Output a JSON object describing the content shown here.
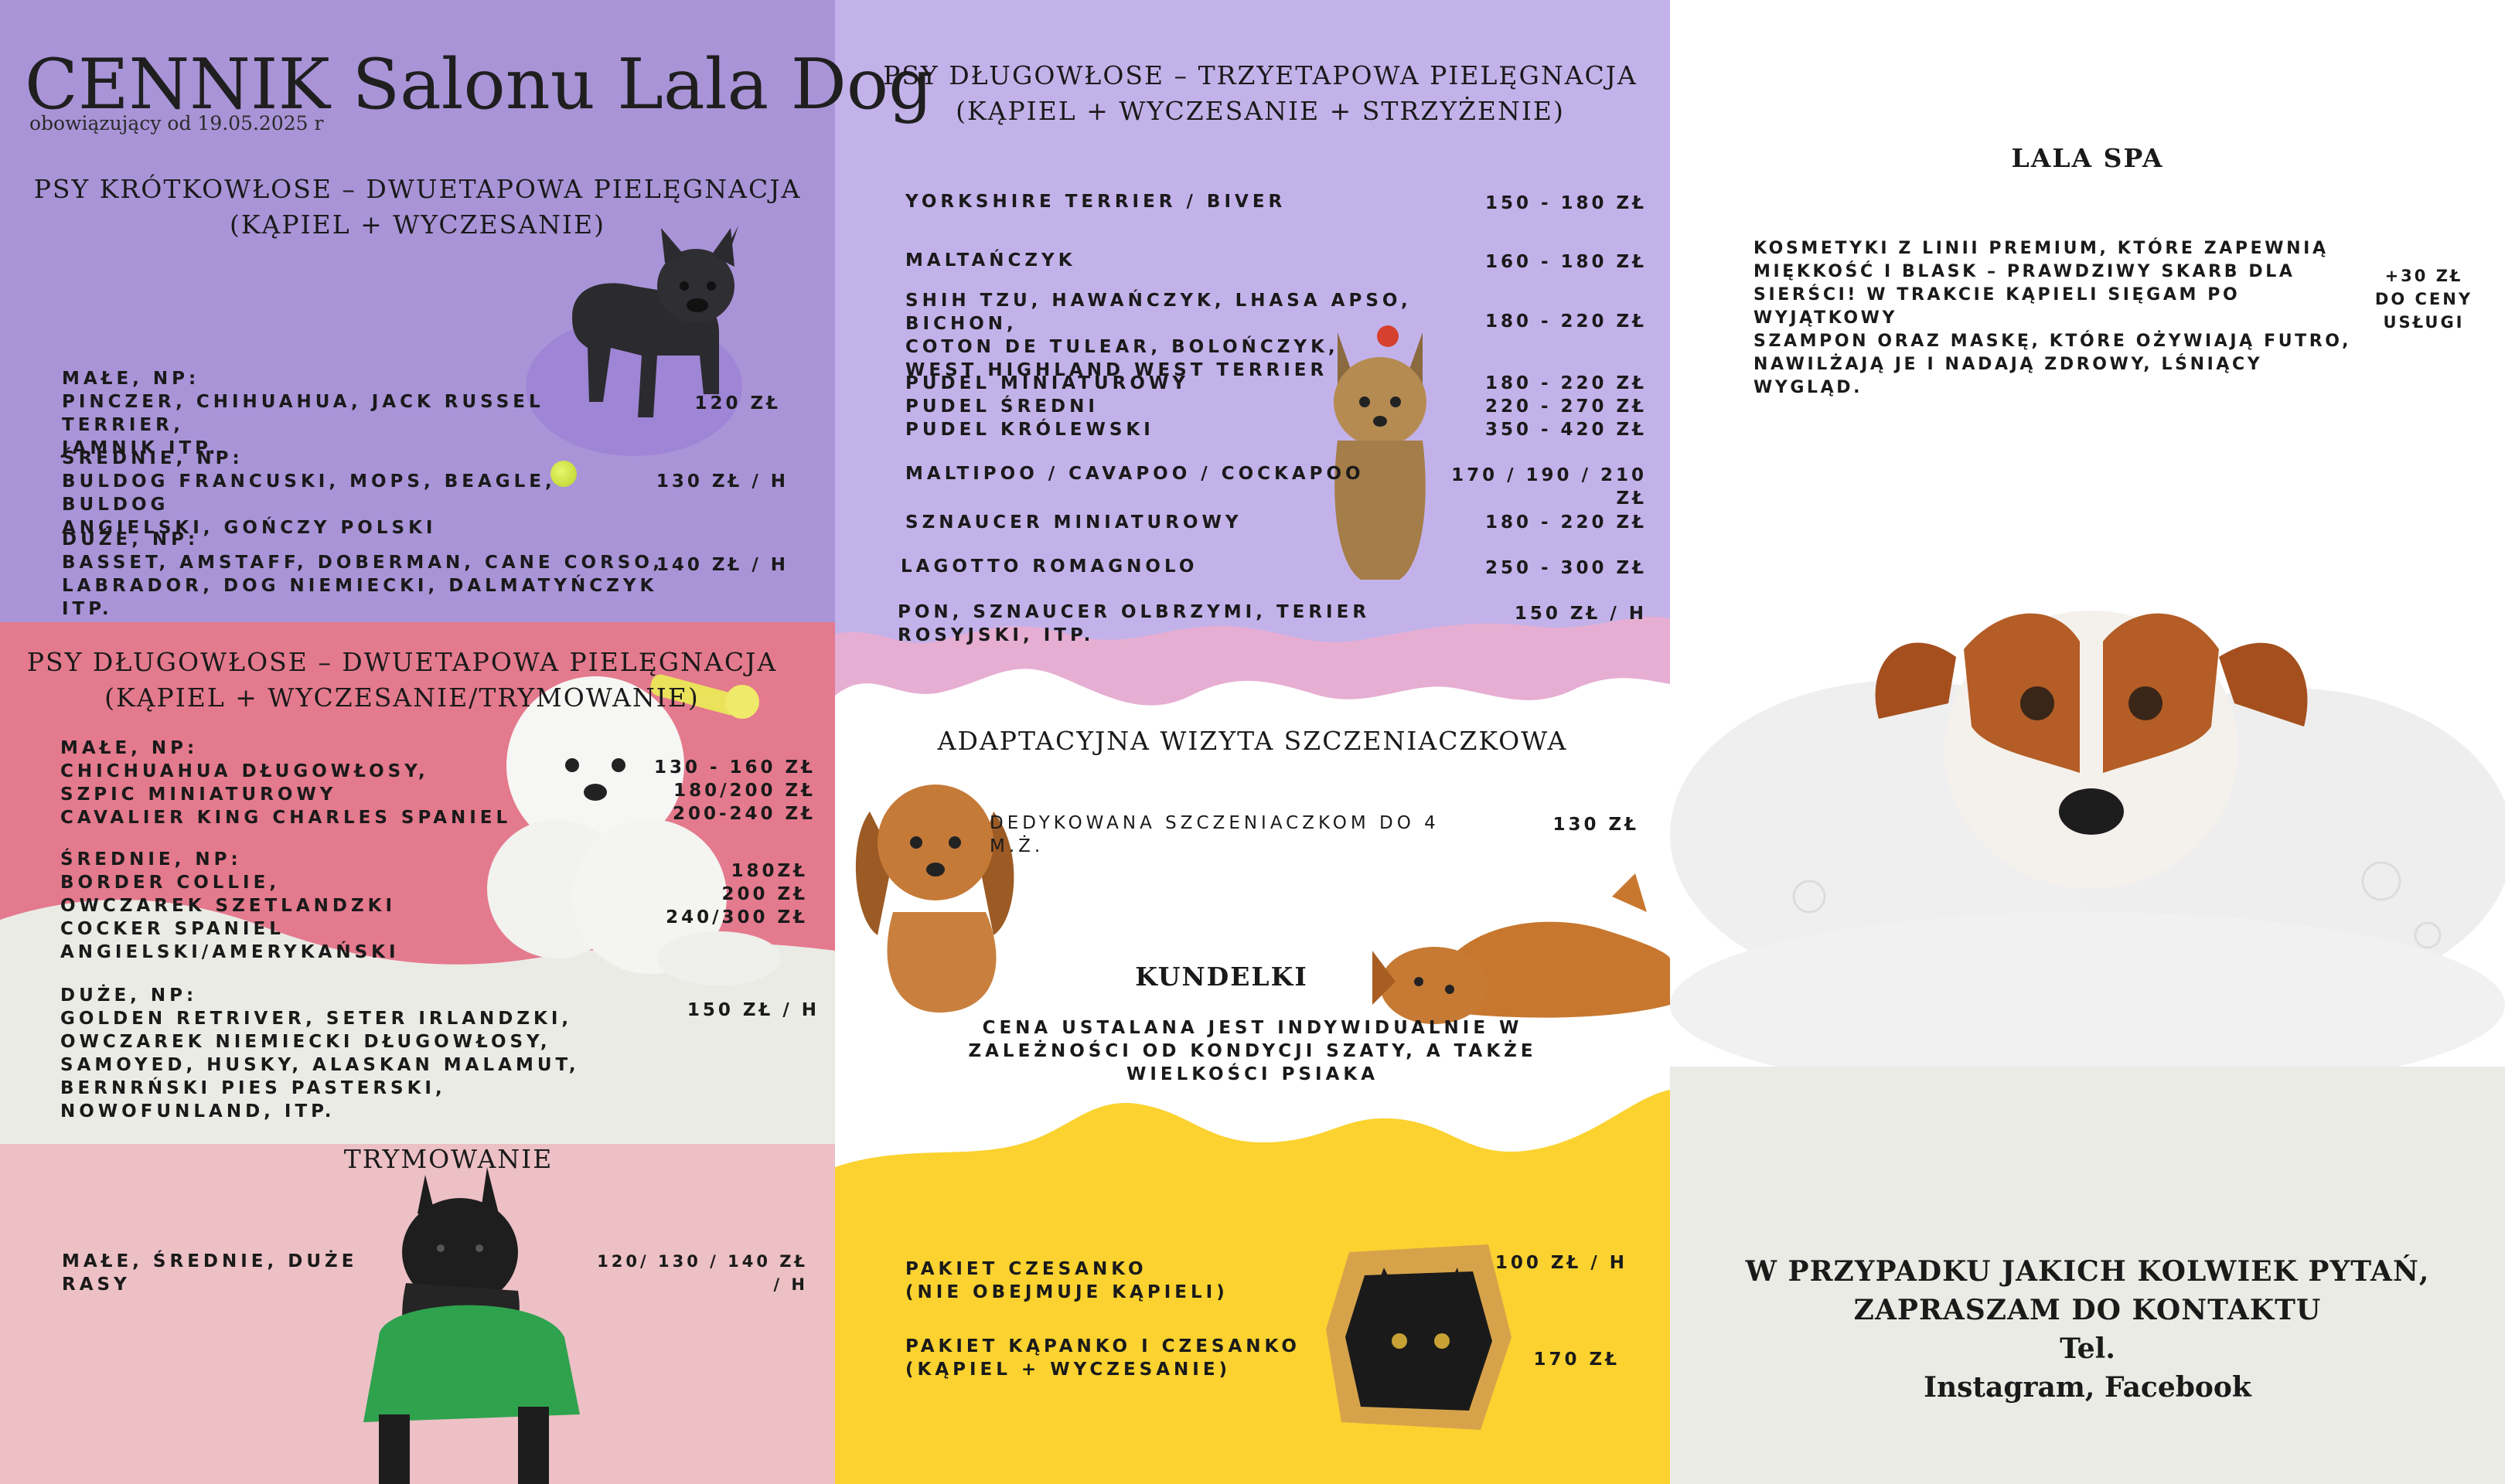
{
  "colors": {
    "lavender": "#a994d8",
    "lilac": "#c3b2ea",
    "coral": "#e47a8d",
    "pink": "#ecc0c5",
    "offwhite": "#ebebe6",
    "yellow": "#fbd22f",
    "wave_pink": "#e6aed2"
  },
  "header": {
    "title": "CENNIK Salonu Lala Dog",
    "subtitle": "obowiązujący od 19.05.2025 r"
  },
  "short_hair": {
    "heading": "PSY KRÓTKOWŁOSE – DWUETAPOWA PIELĘGNACJA\n(KĄPIEL + WYCZESANIE)",
    "rows": [
      {
        "label": "MAŁE, NP:\nPINCZER, CHIHUAHUA, JACK RUSSEL TERRIER,\nJAMNIK  ITP.",
        "price": "120 ZŁ"
      },
      {
        "label": "ŚREDNIE, NP:\nBULDOG FRANCUSKI, MOPS, BEAGLE, BULDOG\nANGIELSKI, GOŃCZY POLSKI",
        "price": "130 ZŁ / H"
      },
      {
        "label": "DUŻE, NP:\nBASSET, AMSTAFF, DOBERMAN, CANE CORSO,\nLABRADOR, DOG NIEMIECKI, DALMATYŃCZYK ITP.",
        "price": "140 ZŁ / H"
      }
    ]
  },
  "long_hair_two": {
    "heading": "PSY DŁUGOWŁOSE – DWUETAPOWA PIELĘGNACJA\n(KĄPIEL + WYCZESANIE/TRYMOWANIE)",
    "rows": [
      {
        "label": "MAŁE, NP:\nCHICHUAHUA DŁUGOWŁOSY,\nSZPIC MINIATUROWY\nCAVALIER KING CHARLES SPANIEL",
        "price": "130 - 160 ZŁ\n180/200 ZŁ\n200-240 ZŁ"
      },
      {
        "label": "ŚREDNIE, NP:\nBORDER COLLIE,\nOWCZAREK SZETLANDZKI\nCOCKER SPANIEL ANGIELSKI/AMERYKAŃSKI",
        "price": "180ZŁ\n200 ZŁ\n240/300 ZŁ"
      },
      {
        "label": "DUŻE, NP:\nGOLDEN RETRIVER, SETER IRLANDZKI,\nOWCZAREK NIEMIECKI DŁUGOWŁOSY,\nSAMOYED, HUSKY, ALASKAN MALAMUT,\nBERNRŃSKI PIES PASTERSKI, NOWOFUNLAND, ITP.",
        "price": "150 ZŁ / H"
      }
    ]
  },
  "trimming": {
    "heading": "TRYMOWANIE",
    "label": "MAŁE, ŚREDNIE, DUŻE RASY",
    "price": "120/ 130 / 140 ZŁ / H"
  },
  "long_hair_three": {
    "heading": "PSY DŁUGOWŁOSE – TRZYETAPOWA PIELĘGNACJA\n(KĄPIEL + WYCZESANIE + STRZYŻENIE)",
    "rows": [
      {
        "label": "YORKSHIRE TERRIER / BIVER",
        "price": "150 - 180 ZŁ"
      },
      {
        "label": "MALTAŃCZYK",
        "price": "160 - 180 ZŁ"
      },
      {
        "label": "SHIH TZU, HAWAŃCZYK, LHASA APSO, BICHON,\nCOTON DE TULEAR, BOLOŃCZYK,\nWEST HIGHLAND WEST TERRIER",
        "price": "180 - 220 ZŁ"
      },
      {
        "label": "PUDEL MINIATUROWY\nPUDEL ŚREDNI\nPUDEL KRÓLEWSKI",
        "price": "180 - 220 ZŁ\n220 - 270 ZŁ\n350 - 420 ZŁ"
      },
      {
        "label": "MALTIPOO / CAVAPOO / COCKAPOO",
        "price": "170 / 190 / 210 ZŁ"
      },
      {
        "label": "SZNAUCER MINIATUROWY",
        "price": "180 - 220 ZŁ"
      },
      {
        "label": "LAGOTTO ROMAGNOLO",
        "price": "250 - 300 ZŁ"
      },
      {
        "label": "PON, SZNAUCER OLBRZYMI, TERIER ROSYJSKI, ITP.",
        "price": "150 ZŁ / H"
      }
    ]
  },
  "puppy": {
    "heading": "ADAPTACYJNA WIZYTA SZCZENIACZKOWA",
    "label": "DEDYKOWANA SZCZENIACZKOM DO 4 M.Ż.",
    "price": "130 ZŁ"
  },
  "mixed": {
    "heading": "KUNDELKI",
    "text": "CENA USTALANA JEST INDYWIDUALNIE W\nZALEŻNOŚCI OD KONDYCJI SZATY, A TAKŻE\nWIELKOŚCI PSIAKA"
  },
  "packages": [
    {
      "label": "PAKIET CZESANKO\n(NIE OBEJMUJE KĄPIELI)",
      "price": "100 ZŁ / H"
    },
    {
      "label": "PAKIET KĄPANKO I CZESANKO\n(KĄPIEL + WYCZESANIE)",
      "price": "170 ZŁ"
    }
  ],
  "spa": {
    "heading": "LALA SPA",
    "text": "KOSMETYKI Z LINII PREMIUM, KTÓRE ZAPEWNIĄ\nMIĘKKOŚĆ I BLASK – PRAWDZIWY SKARB DLA\nSIERŚCI! W TRAKCIE KĄPIELI SIĘGAM PO WYJĄTKOWY\nSZAMPON ORAZ MASKĘ, KTÓRE OŻYWIAJĄ FUTRO,\nNAWILŻAJĄ JE I NADAJĄ ZDROWY, LŚNIĄCY WYGLĄD.",
    "price": "+30 ZŁ\nDO CENY\nUSŁUGI"
  },
  "contact": {
    "line1": "W PRZYPADKU JAKICH KOLWIEK PYTAŃ,",
    "line2": "ZAPRASZAM DO KONTAKTU",
    "line3": "Tel.",
    "line4": "Instagram, Facebook"
  },
  "icons": [
    "french-bulldog-photo",
    "tennis-ball-icon",
    "bichon-photo",
    "comb-icon",
    "scottish-terrier-photo",
    "yorkshire-photo",
    "spaniel-puppy-photo",
    "lying-dog-photo",
    "black-cat-photo",
    "jack-russell-bath-photo"
  ]
}
